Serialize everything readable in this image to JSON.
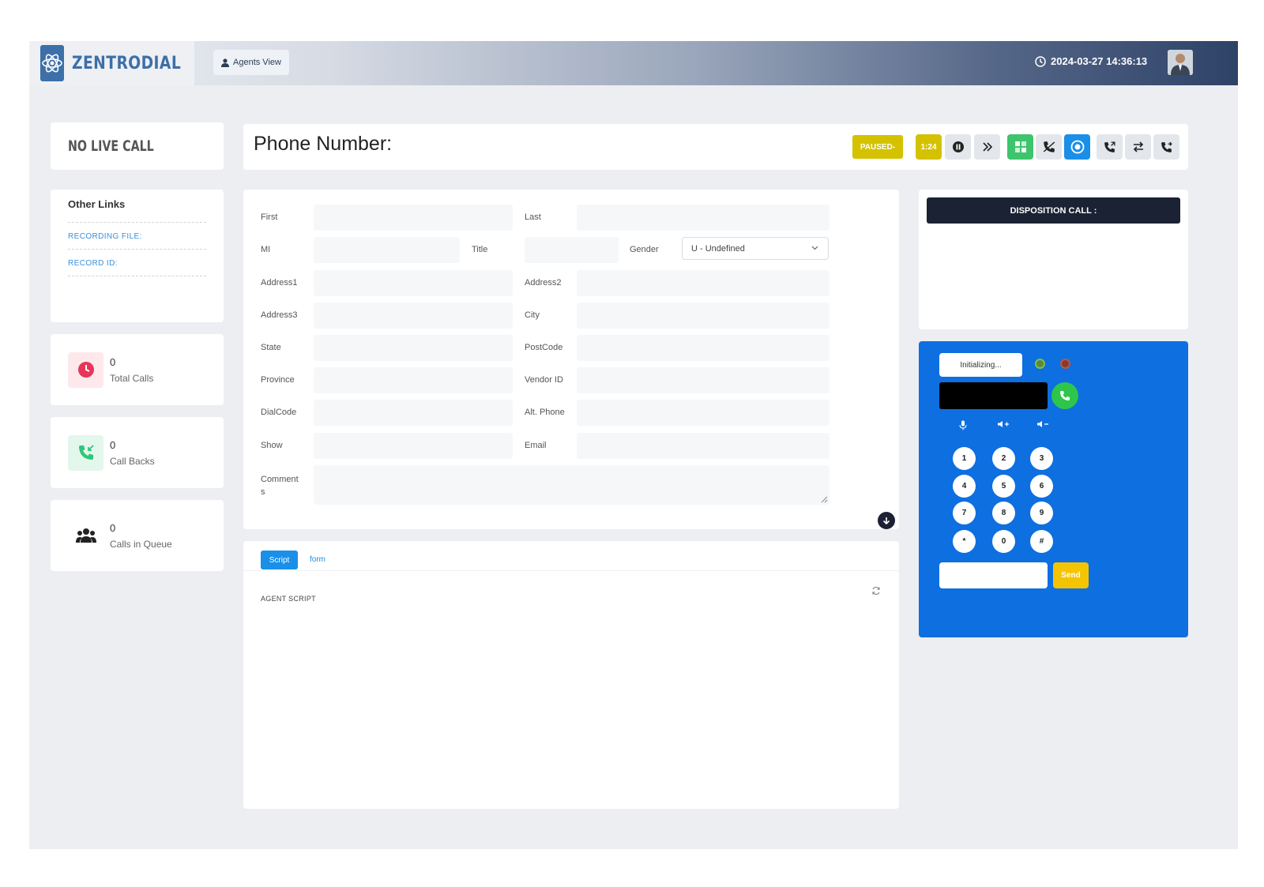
{
  "app": {
    "brand": "ZENTRODIAL",
    "view_button": "Agents View",
    "datetime": "2024-03-27 14:36:13"
  },
  "status": {
    "no_live_call": "NO LIVE CALL"
  },
  "other_links": {
    "title": "Other Links",
    "recording_file": "RECORDING FILE:",
    "record_id": "RECORD ID:"
  },
  "stats": [
    {
      "value": "0",
      "label": "Total Calls",
      "color": "#e8355b",
      "icon": "clock-icon"
    },
    {
      "value": "0",
      "label": "Call Backs",
      "color": "#2ec67a",
      "icon": "incoming-call-icon"
    },
    {
      "value": "0",
      "label": "Calls in Queue",
      "color": "#222222",
      "icon": "users-icon"
    }
  ],
  "phone": {
    "title": "Phone Number:",
    "status_badge": "PAUSED-",
    "timer": "1:24"
  },
  "form": {
    "first": "First",
    "last": "Last",
    "mi": "MI",
    "title": "Title",
    "gender": "Gender",
    "gender_value": "U - Undefined",
    "address1": "Address1",
    "address2": "Address2",
    "address3": "Address3",
    "city": "City",
    "state": "State",
    "postcode": "PostCode",
    "province": "Province",
    "vendor_id": "Vendor ID",
    "dialcode": "DialCode",
    "alt_phone": "Alt. Phone",
    "show": "Show",
    "email": "Email",
    "comments": "Comment s"
  },
  "script": {
    "tab_script": "Script",
    "tab_form": "form",
    "heading": "AGENT SCRIPT"
  },
  "disposition": {
    "button": "DISPOSITION CALL :"
  },
  "dialer": {
    "status": "Initializing...",
    "keys": [
      "1",
      "2",
      "3",
      "4",
      "5",
      "6",
      "7",
      "8",
      "9",
      "*",
      "0",
      "#"
    ],
    "send": "Send"
  },
  "colors": {
    "accent": "#1a8fe8",
    "dialer_bg": "#0e6fe0",
    "paused": "#d4c200",
    "dark": "#1b2233"
  }
}
